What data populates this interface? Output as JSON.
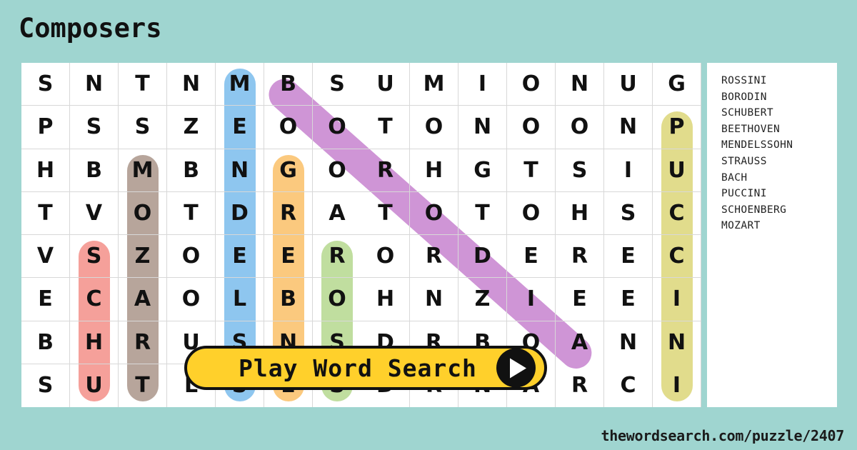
{
  "title": "Composers",
  "footer": "thewordsearch.com/puzzle/2407",
  "play_button": {
    "label": "Play Word Search",
    "icon": "play-triangle-icon"
  },
  "colors": {
    "background": "#9fd5d0",
    "card": "#ffffff",
    "grid_line": "#d8d8d8",
    "button": "#ffd02b",
    "text": "#111111",
    "hl_purple": "#cf95d6",
    "hl_blue": "#8ec6ef",
    "hl_orange": "#fbc97e",
    "hl_green": "#c0de9f",
    "hl_red": "#f5a09a",
    "hl_brown": "#b7a59b",
    "hl_yellow": "#e1dc8c"
  },
  "word_list": {
    "words": [
      "ROSSINI",
      "BORODIN",
      "SCHUBERT",
      "BEETHOVEN",
      "MENDELSSOHN",
      "STRAUSS",
      "BACH",
      "PUCCINI",
      "SCHOENBERG",
      "MOZART"
    ]
  },
  "grid": {
    "rows": 8,
    "cols": 14,
    "letters": [
      [
        "S",
        "N",
        "T",
        "N",
        "M",
        "B",
        "S",
        "U",
        "M",
        "I",
        "O",
        "N",
        "U",
        "G"
      ],
      [
        "P",
        "S",
        "S",
        "Z",
        "E",
        "O",
        "O",
        "T",
        "O",
        "N",
        "O",
        "O",
        "N",
        "P"
      ],
      [
        "H",
        "B",
        "M",
        "B",
        "N",
        "G",
        "O",
        "R",
        "H",
        "G",
        "T",
        "S",
        "I",
        "U"
      ],
      [
        "T",
        "V",
        "O",
        "T",
        "D",
        "R",
        "A",
        "T",
        "O",
        "T",
        "O",
        "H",
        "S",
        "C"
      ],
      [
        "V",
        "S",
        "Z",
        "O",
        "E",
        "E",
        "R",
        "O",
        "R",
        "D",
        "E",
        "R",
        "E",
        "C"
      ],
      [
        "E",
        "C",
        "A",
        "O",
        "L",
        "B",
        "O",
        "H",
        "N",
        "Z",
        "I",
        "E",
        "E",
        "I"
      ],
      [
        "B",
        "H",
        "R",
        "U",
        "S",
        "N",
        "S",
        "D",
        "R",
        "B",
        "O",
        "A",
        "N",
        "N"
      ],
      [
        "S",
        "U",
        "T",
        "L",
        "S",
        "E",
        "S",
        "D",
        "R",
        "N",
        "A",
        "R",
        "C",
        "I"
      ]
    ]
  },
  "highlights": [
    {
      "word": "MENDELSSOHN",
      "color": "#8ec6ef",
      "orientation": "vertical",
      "col": 5,
      "row_start": 1,
      "row_end": 8
    },
    {
      "word": "SCHOENBERG",
      "color": "#fbc97e",
      "orientation": "vertical",
      "col": 6,
      "row_start": 3,
      "row_end": 8
    },
    {
      "word": "ROSSINI",
      "color": "#c0de9f",
      "orientation": "vertical",
      "col": 7,
      "row_start": 5,
      "row_end": 8
    },
    {
      "word": "MOZART",
      "color": "#b7a59b",
      "orientation": "vertical",
      "col": 3,
      "row_start": 3,
      "row_end": 8
    },
    {
      "word": "SCHUBERT",
      "color": "#f5a09a",
      "orientation": "vertical",
      "col": 2,
      "row_start": 5,
      "row_end": 8
    },
    {
      "word": "PUCCINI",
      "color": "#e1dc8c",
      "orientation": "vertical",
      "col": 14,
      "row_start": 2,
      "row_end": 8
    },
    {
      "word": "BORODIN",
      "color": "#cf95d6",
      "orientation": "diagonal",
      "col_start": 6,
      "row_start": 1,
      "col_end": 12,
      "row_end": 7
    }
  ]
}
